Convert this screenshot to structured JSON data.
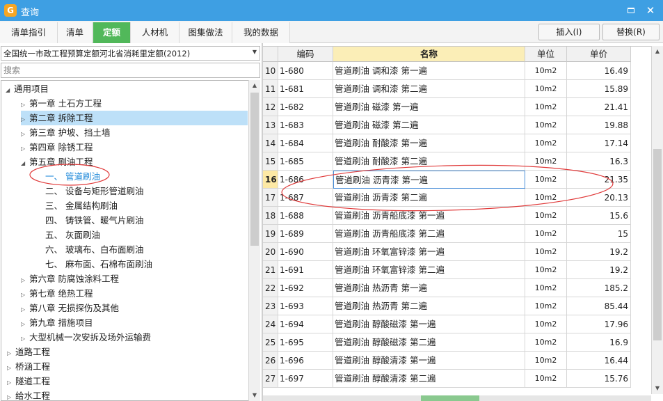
{
  "window": {
    "title": "查询",
    "app_icon_glyph": "G",
    "controls": [
      "maximize-icon",
      "close-icon"
    ],
    "close_glyph": "✕"
  },
  "tabs": [
    {
      "label": "清单指引",
      "active": false
    },
    {
      "label": "清单",
      "active": false
    },
    {
      "label": "定额",
      "active": true
    },
    {
      "label": "人材机",
      "active": false
    },
    {
      "label": "图集做法",
      "active": false
    },
    {
      "label": "我的数据",
      "active": false
    }
  ],
  "actions": {
    "insert_label": "插入(I)",
    "replace_label": "替换(R)"
  },
  "left_panel": {
    "library_select": "全国统一市政工程预算定额河北省消耗里定额(2012)",
    "search_placeholder": "搜索",
    "tree": [
      {
        "label": "通用项目",
        "level": 0,
        "expanded": true,
        "toggle": "◢"
      },
      {
        "label": "第一章 土石方工程",
        "level": 1,
        "toggle": "▷"
      },
      {
        "label": "第二章 拆除工程",
        "level": 1,
        "toggle": "▷",
        "selected": true
      },
      {
        "label": "第三章 护坡、挡土墙",
        "level": 1,
        "toggle": "▷"
      },
      {
        "label": "第四章 除锈工程",
        "level": 1,
        "toggle": "▷"
      },
      {
        "label": "第五章 刷油工程",
        "level": 1,
        "expanded": true,
        "toggle": "◢"
      },
      {
        "label": "一、 管道刷油",
        "level": 2,
        "highlighted": true
      },
      {
        "label": "二、 设备与矩形管道刷油",
        "level": 2
      },
      {
        "label": "三、 金属结构刷油",
        "level": 2
      },
      {
        "label": "四、 铸铁管、暖气片刷油",
        "level": 2
      },
      {
        "label": "五、 灰面刷油",
        "level": 2
      },
      {
        "label": "六、 玻璃布、白布面刷油",
        "level": 2
      },
      {
        "label": "七、 麻布面、石棉布面刷油",
        "level": 2
      },
      {
        "label": "第六章 防腐蚀涂料工程",
        "level": 1,
        "toggle": "▷"
      },
      {
        "label": "第七章 绝热工程",
        "level": 1,
        "toggle": "▷"
      },
      {
        "label": "第八章 无损探伤及其他",
        "level": 1,
        "toggle": "▷"
      },
      {
        "label": "第九章 措施项目",
        "level": 1,
        "toggle": "▷"
      },
      {
        "label": "大型机械一次安拆及场外运输费",
        "level": 1,
        "toggle": "▷"
      },
      {
        "label": "道路工程",
        "level": 0,
        "toggle": "▷"
      },
      {
        "label": "桥涵工程",
        "level": 0,
        "toggle": "▷"
      },
      {
        "label": "隧道工程",
        "level": 0,
        "toggle": "▷"
      },
      {
        "label": "给水工程",
        "level": 0,
        "toggle": "▷"
      }
    ]
  },
  "grid": {
    "columns": {
      "index": "",
      "code": "编码",
      "name": "名称",
      "unit": "单位",
      "price": "单价"
    },
    "current_row": "16",
    "rows": [
      {
        "idx": "10",
        "code": "1-680",
        "name": "管道刷油 调和漆 第一遍",
        "unit": "10m2",
        "price": "16.49"
      },
      {
        "idx": "11",
        "code": "1-681",
        "name": "管道刷油 调和漆 第二遍",
        "unit": "10m2",
        "price": "15.89"
      },
      {
        "idx": "12",
        "code": "1-682",
        "name": "管道刷油 磁漆 第一遍",
        "unit": "10m2",
        "price": "21.41"
      },
      {
        "idx": "13",
        "code": "1-683",
        "name": "管道刷油 磁漆 第二遍",
        "unit": "10m2",
        "price": "19.88"
      },
      {
        "idx": "14",
        "code": "1-684",
        "name": "管道刷油 耐酸漆 第一遍",
        "unit": "10m2",
        "price": "17.14"
      },
      {
        "idx": "15",
        "code": "1-685",
        "name": "管道刷油 耐酸漆 第二遍",
        "unit": "10m2",
        "price": "16.3"
      },
      {
        "idx": "16",
        "code": "1-686",
        "name": "管道刷油 沥青漆 第一遍",
        "unit": "10m2",
        "price": "21.35"
      },
      {
        "idx": "17",
        "code": "1-687",
        "name": "管道刷油 沥青漆 第二遍",
        "unit": "10m2",
        "price": "20.13"
      },
      {
        "idx": "18",
        "code": "1-688",
        "name": "管道刷油 沥青船底漆 第一遍",
        "unit": "10m2",
        "price": "15.6"
      },
      {
        "idx": "19",
        "code": "1-689",
        "name": "管道刷油 沥青船底漆 第二遍",
        "unit": "10m2",
        "price": "15"
      },
      {
        "idx": "20",
        "code": "1-690",
        "name": "管道刷油 环氧富锌漆 第一遍",
        "unit": "10m2",
        "price": "19.2"
      },
      {
        "idx": "21",
        "code": "1-691",
        "name": "管道刷油 环氧富锌漆 第二遍",
        "unit": "10m2",
        "price": "19.2"
      },
      {
        "idx": "22",
        "code": "1-692",
        "name": "管道刷油 热沥青 第一遍",
        "unit": "10m2",
        "price": "185.2"
      },
      {
        "idx": "23",
        "code": "1-693",
        "name": "管道刷油 热沥青 第二遍",
        "unit": "10m2",
        "price": "85.44"
      },
      {
        "idx": "24",
        "code": "1-694",
        "name": "管道刷油 醇酸磁漆 第一遍",
        "unit": "10m2",
        "price": "17.96"
      },
      {
        "idx": "25",
        "code": "1-695",
        "name": "管道刷油 醇酸磁漆 第二遍",
        "unit": "10m2",
        "price": "16.9"
      },
      {
        "idx": "26",
        "code": "1-696",
        "name": "管道刷油 醇酸清漆 第一遍",
        "unit": "10m2",
        "price": "16.44"
      },
      {
        "idx": "27",
        "code": "1-697",
        "name": "管道刷油 醇酸清漆 第二遍",
        "unit": "10m2",
        "price": "15.76"
      }
    ]
  },
  "colors": {
    "titlebar": "#3e9fe3",
    "active_tab": "#51b85a",
    "name_header": "#fbeeb7",
    "annotation_ellipse": "#e03a3a",
    "tree_selection": "#bde0f8",
    "tree_highlight_text": "#1a86d8"
  },
  "annotations": [
    "ellipse around tree item 管道刷油",
    "ellipse around grid rows 16-17"
  ]
}
